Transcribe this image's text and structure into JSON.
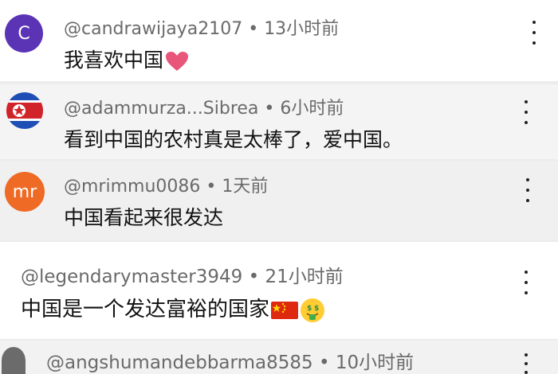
{
  "comments": [
    {
      "user": "@candrawijaya2107",
      "time": "13小时前",
      "text": "我喜欢中国",
      "avatar_letter": "C",
      "avatar_color": "#5b34b6",
      "emoji": [
        "heart-icon"
      ]
    },
    {
      "user": "@adammurza...Sibrea",
      "time": "6小时前",
      "text": "看到中国的农村真是太棒了，爱中国。",
      "avatar_icon": "north-korea-flag-avatar"
    },
    {
      "user": "@mrimmu0086",
      "time": "1天前",
      "text": "中国看起来很发达",
      "avatar_letter": "mr",
      "avatar_color": "#ef6a24"
    },
    {
      "user": "@legendarymaster3949",
      "time": "21小时前",
      "text": "中国是一个发达富裕的国家",
      "emoji": [
        "china-flag-icon",
        "money-mouth-face-icon"
      ]
    },
    {
      "user": "@angshumandebbarma8585",
      "time": "10小时前",
      "text": ""
    }
  ],
  "separator": "•"
}
